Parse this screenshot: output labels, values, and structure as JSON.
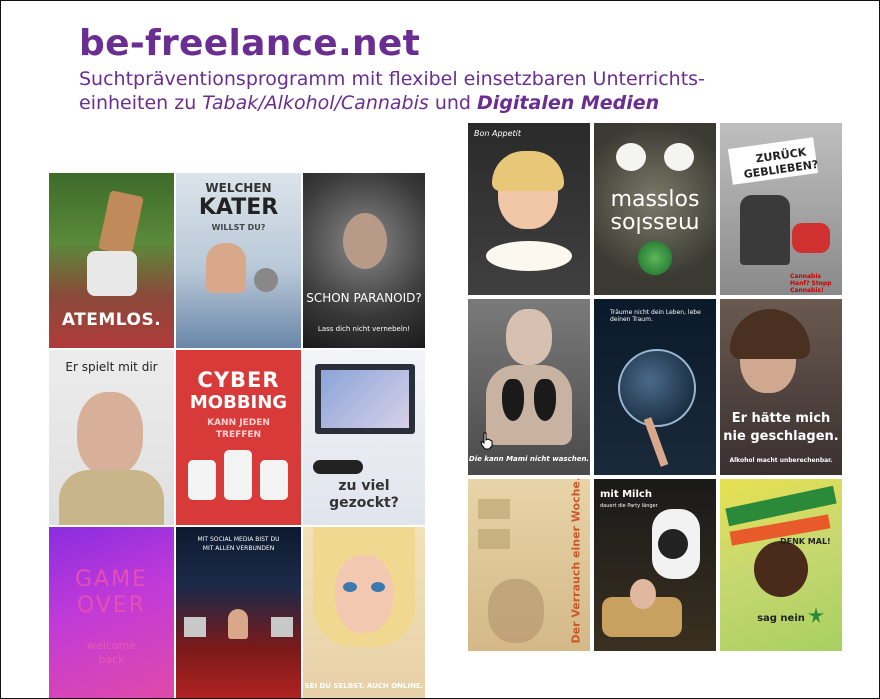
{
  "header": {
    "title": "be-freelance.net",
    "subtitle_line1": "Suchtpräventionsprogramm mit flexibel einsetzbaren Unterrichts-",
    "subtitle_line2_prefix": "einheiten zu ",
    "subtitle_italic": "Tabak/Alkohol/Cannabis",
    "subtitle_and": " und ",
    "subtitle_bold_italic": "Digitalen Medien"
  },
  "posters_left": [
    {
      "id": "atemlos",
      "text": "ATEMLOS."
    },
    {
      "id": "kater",
      "text_top": "WELCHEN",
      "text_mid": "KATER",
      "text_small": "WILLST DU?"
    },
    {
      "id": "paranoid",
      "text_main": "SCHON PARANOID?",
      "text_small": "Lass dich nicht vernebeln!"
    },
    {
      "id": "spielt",
      "text": "Er spielt mit dir"
    },
    {
      "id": "cyber",
      "text_a": "CYBER",
      "text_b": "MOBBING",
      "text_c": "KANN JEDEN",
      "text_d": "TREFFEN"
    },
    {
      "id": "gezockt",
      "text_a": "zu viel",
      "text_b": "gezockt?"
    },
    {
      "id": "gameover",
      "text_a": "GAME",
      "text_b": "OVER",
      "text_c": "welcome",
      "text_d": "back"
    },
    {
      "id": "social",
      "text": "MIT SOCIAL MEDIA BIST DU MIT ALLEN VERBUNDEN"
    },
    {
      "id": "online",
      "text": "SEI DU SELBST. AUCH ONLINE."
    }
  ],
  "posters_right": [
    {
      "id": "appetit",
      "text": "Bon Appetit"
    },
    {
      "id": "masslos",
      "text_a": "masslos",
      "text_b": "masslos"
    },
    {
      "id": "zurueck",
      "text_a": "ZURÜCK",
      "text_b": "GEBLIEBEN?",
      "text_c": "Cannabis Hanf? Stopp Cannabis!"
    },
    {
      "id": "lunge",
      "text": "Die kann Mami nicht waschen."
    },
    {
      "id": "traeume",
      "text": "Träume nicht dein Leben, lebe deinen Traum."
    },
    {
      "id": "haette",
      "text_a": "Er hätte mich",
      "text_b": "nie geschlagen.",
      "text_c": "Alkohol macht unberechenbar."
    },
    {
      "id": "verrauch",
      "text": "Der Verrauch einer Woche."
    },
    {
      "id": "milch",
      "text_a": "mit Milch",
      "text_b": "dauert die Party länger"
    },
    {
      "id": "denkmal",
      "text_a": "DENK MAL!",
      "text_b": "sag nein"
    }
  ],
  "colors": {
    "brand_purple": "#6a2d91"
  }
}
